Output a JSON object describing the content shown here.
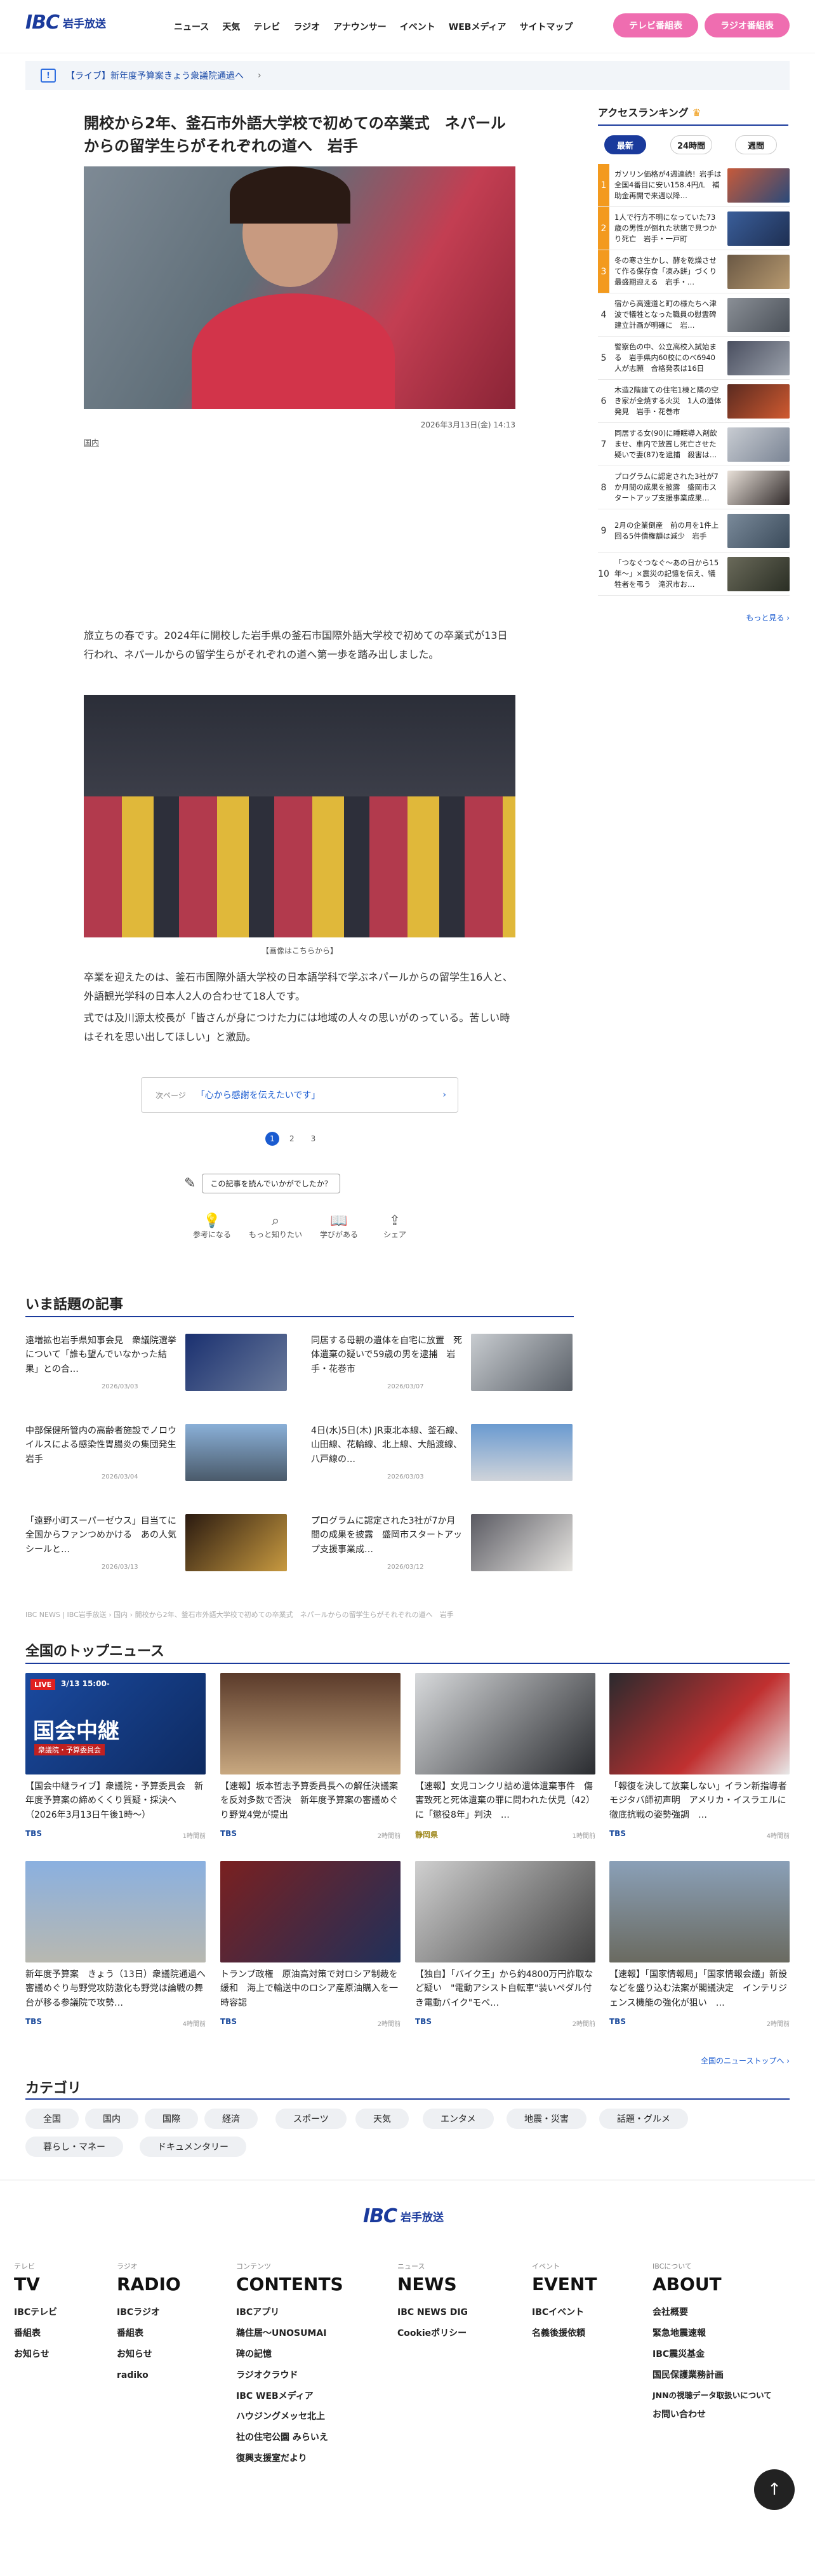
{
  "header": {
    "logo": {
      "mark": "IBC",
      "name": "岩手放送"
    },
    "nav": [
      "ニュース",
      "天気",
      "テレビ",
      "ラジオ",
      "アナウンサー",
      "イベント",
      "WEBメディア",
      "サイトマップ"
    ],
    "tv_button": "テレビ番組表",
    "radio_button": "ラジオ番組表",
    "accent_color": "#ef6db0"
  },
  "ticker": {
    "text": "【ライブ】新年度予算案きょう衆議院通過へ",
    "icon": "live-icon"
  },
  "article": {
    "title": "開校から2年、釜石市外語大学校で初めての卒業式　ネパールからの留学生らがそれぞれの道へ　岩手",
    "date": "2026年3月13日(金) 14:13",
    "category": "国内",
    "paragraph1": "旅立ちの春です。2024年に開校した岩手県の釜石市国際外語大学校で初めての卒業式が13日行われ、ネパールからの留学生らがそれぞれの道へ第一歩を踏み出しました。",
    "image_caption": "【画像はこちらから】",
    "paragraph2": "卒業を迎えたのは、釜石市国際外語大学校の日本語学科で学ぶネパールからの留学生16人と、外語観光学科の日本人2人の合わせて18人です。",
    "paragraph3": "式では及川源太校長が「皆さんが身につけた力には地域の人々の思いがのっている。苦しい時はそれを思い出してほしい」と激励。",
    "next_page_label": "次ページ",
    "next_page_title": "「心から感謝を伝えたいです」",
    "pages": [
      "1",
      "2",
      "3"
    ],
    "feedback_prompt": "この記事を読んでいかがでしたか？",
    "reactions": [
      "参考になる",
      "もっと知りたい",
      "学びがある",
      "シェア"
    ]
  },
  "ranking": {
    "title": "アクセスランキング",
    "tabs": [
      "最新",
      "24時間",
      "週間"
    ],
    "items": [
      {
        "rank": "1",
        "text": "ガソリン価格が4週連続！岩手は全国4番目に安い158.4円/L　補助金再開で来週以降…"
      },
      {
        "rank": "2",
        "text": "1人で行方不明になっていた73歳の男性が倒れた状態で見つかり死亡　岩手・一戸町"
      },
      {
        "rank": "3",
        "text": "冬の寒さ生かし、酵を乾燥させて作る保存食「凍み餅」づくり最盛期迎える　岩手・…"
      },
      {
        "rank": "4",
        "text": "宿から高速道と町の様たちへ津波で犠牲となった職員の慰霊碑建立計画が明確に　岩…"
      },
      {
        "rank": "5",
        "text": "警察色の中、公立高校入試始まる　岩手県内60校にのべ6940人が志願　合格発表は16日"
      },
      {
        "rank": "6",
        "text": "木造2階建ての住宅1棟と隣の空き家が全焼する火災　1人の遺体発見　岩手・花巻市"
      },
      {
        "rank": "7",
        "text": "同居する女(90)に睡眠導入剤飲ませ、車内で放置し死亡させた疑いで妻(87)を逮捕　殺害は…"
      },
      {
        "rank": "8",
        "text": "プログラムに認定された3社が7か月間の成果を披露　盛岡市スタートアップ支援事業成果…"
      },
      {
        "rank": "9",
        "text": "2月の企業倒産　前の月を1件上回る5件債権額は減少　岩手"
      },
      {
        "rank": "10",
        "text": "「つなぐつなぐ〜あの日から15年〜」×震災の記憶を伝え、犠牲者を弔う　滝沢市お…"
      }
    ],
    "more": "もっと見る"
  },
  "trending": {
    "title": "いま話題の記事",
    "items": [
      {
        "text": "遠増拡也岩手県知事会見　衆議院選挙について「誰も望んでいなかった結果」との合…",
        "date": "2026/03/03"
      },
      {
        "text": "同居する母親の遺体を自宅に放置　死体遺棄の疑いで59歳の男を逮捕　岩手・花巻市",
        "date": "2026/03/07"
      },
      {
        "text": "中部保健所管内の高齢者施設でノロウイルスによる感染性胃腸炎の集団発生　岩手",
        "date": "2026/03/04"
      },
      {
        "text": "4日(水)5日(木) JR東北本線、釜石線、山田線、花輪線、北上線、大船渡線、八戸線の…",
        "date": "2026/03/03"
      },
      {
        "text": "「遠野小町スーパーゼウス」目当てに全国からファンつめかける　あの人気シールと…",
        "date": "2026/03/13"
      },
      {
        "text": "プログラムに認定された3社が7か月間の成果を披露　盛岡市スタートアップ支援事業成…",
        "date": "2026/03/12"
      }
    ]
  },
  "breadcrumb": "IBC NEWS | IBC岩手放送 › 国内 › 開校から2年、釜石市外語大学校で初めての卒業式　ネパールからの留学生らがそれぞれの道へ　岩手",
  "top_news": {
    "title": "全国のトップニュース",
    "more": "全国のニューストップへ",
    "items": [
      {
        "text": "【国会中継ライブ】衆議院・予算委員会　新年度予算案の締めくくり質疑・採決へ（2026年3月13日午後1時〜）",
        "source": "TBS",
        "time": "1時間前",
        "live_label": "LIVE",
        "live_time": "3/13 15:00-",
        "overlay": "国会中継",
        "overlay_sub": "衆議院・予算委員会"
      },
      {
        "text": "【速報】坂本哲志予算委員長への解任決議案を反対多数で否決　新年度予算案の審議めぐり野党4党が提出",
        "source": "TBS",
        "time": "2時間前"
      },
      {
        "text": "【速報】女児コンクリ詰め遺体遺棄事件　傷害致死と死体遺棄の罪に問われた伏見（42）に「懲役8年」判決　…",
        "source": "静岡県",
        "time": "1時間前"
      },
      {
        "text": "「報復を決して放棄しない」イラン新指導者モジタバ師初声明　アメリカ・イスラエルに徹底抗戦の姿勢強調　…",
        "source": "TBS",
        "time": "4時間前"
      },
      {
        "text": "新年度予算案　きょう（13日）衆議院通過へ　審議めぐり与野党攻防激化も野党は論戦の舞台が移る参議院で攻勢…",
        "source": "TBS",
        "time": "4時間前"
      },
      {
        "text": "トランプ政権　原油高対策で対ロシア制裁を緩和　海上で輸送中のロシア産原油購入を一時容認",
        "source": "TBS",
        "time": "2時間前"
      },
      {
        "text": "【独自】「バイク王」から約4800万円詐取など疑い　\"電動アシスト自転車\"装いペダル付き電動バイク\"モペ…",
        "source": "TBS",
        "time": "2時間前"
      },
      {
        "text": "【速報】「国家情報局」「国家情報会議」新設などを盛り込む法案が閣議決定　インテリジェンス機能の強化が狙い　…",
        "source": "TBS",
        "time": "2時間前"
      }
    ]
  },
  "categories": {
    "title": "カテゴリ",
    "items": [
      "全国",
      "国内",
      "国際",
      "経済",
      "スポーツ",
      "天気",
      "エンタメ",
      "地震・災害",
      "話題・グルメ",
      "暮らし・マネー",
      "ドキュメンタリー"
    ]
  },
  "footer": {
    "logo": {
      "mark": "IBC",
      "name": "岩手放送"
    },
    "columns": [
      {
        "category": "テレビ",
        "heading": "TV",
        "links": [
          "IBCテレビ",
          "番組表",
          "お知らせ"
        ]
      },
      {
        "category": "ラジオ",
        "heading": "RADIO",
        "links": [
          "IBCラジオ",
          "番組表",
          "お知らせ",
          "radiko"
        ]
      },
      {
        "category": "コンテンツ",
        "heading": "CONTENTS",
        "links": [
          "IBCアプリ",
          "鵜住居〜UNOSUMAI",
          "碑の記憶",
          "ラジオクラウド",
          "IBC WEBメディア",
          "ハウジングメッセ北上",
          "社の住宅公園 みらいえ",
          "復興支援室だより"
        ]
      },
      {
        "category": "ニュース",
        "heading": "NEWS",
        "links": [
          "IBC NEWS DIG",
          "Cookieポリシー"
        ]
      },
      {
        "category": "イベント",
        "heading": "EVENT",
        "links": [
          "IBCイベント",
          "名義後援依頼"
        ]
      },
      {
        "category": "IBCについて",
        "heading": "ABOUT",
        "links": [
          "会社概要",
          "緊急地震速報",
          "IBC震災基金",
          "国民保護業務計画",
          "JNNの視聴データ取扱いについて",
          "お問い合わせ"
        ]
      }
    ]
  }
}
